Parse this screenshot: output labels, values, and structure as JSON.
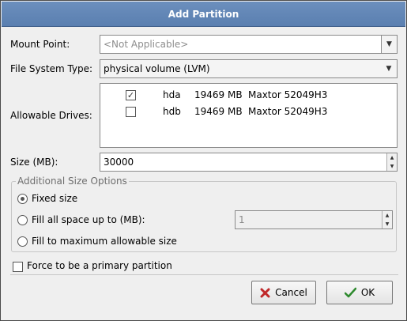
{
  "window": {
    "title": "Add Partition"
  },
  "mount_point": {
    "label": "Mount Point:",
    "value": "<Not Applicable>"
  },
  "fs_type": {
    "label": "File System Type:",
    "value": "physical volume (LVM)"
  },
  "drives": {
    "label": "Allowable Drives:",
    "rows": [
      {
        "checked": true,
        "name": "hda",
        "size": "19469 MB",
        "model": "Maxtor 52049H3"
      },
      {
        "checked": false,
        "name": "hdb",
        "size": "19469 MB",
        "model": "Maxtor 52049H3"
      }
    ]
  },
  "size": {
    "label": "Size (MB):",
    "value": "30000"
  },
  "size_options": {
    "title": "Additional Size Options",
    "fixed": "Fixed size",
    "fill_up_to": "Fill all space up to (MB):",
    "fill_up_to_value": "1",
    "fill_max": "Fill to maximum allowable size",
    "selected": "fixed"
  },
  "force_primary": {
    "label": "Force to be a primary partition",
    "checked": false
  },
  "buttons": {
    "cancel": "Cancel",
    "ok": "OK"
  },
  "colors": {
    "titlebar": "#6c8fbd",
    "dialog_bg": "#efefef",
    "cancel_icon": "#c0282a",
    "ok_icon": "#2e8a2e"
  }
}
